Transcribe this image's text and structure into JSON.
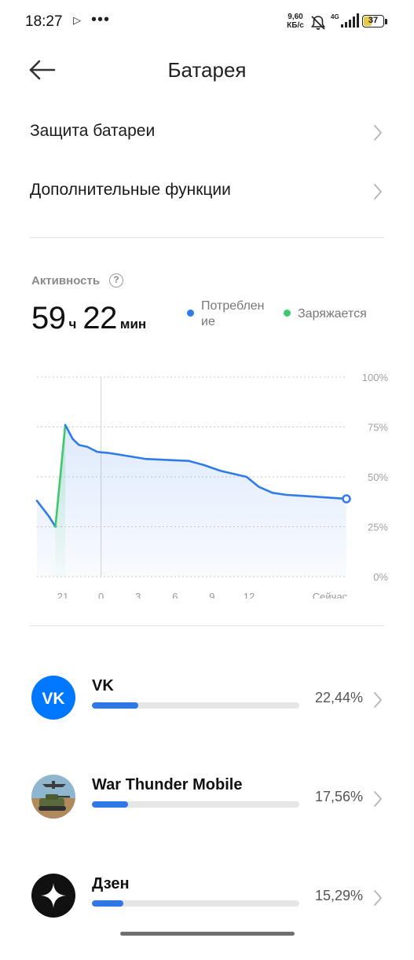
{
  "status_bar": {
    "time": "18:27",
    "speed_value": "9,60",
    "speed_unit": "КБ/с",
    "network": "4G",
    "battery": "37",
    "battery_level": 0.37
  },
  "header": {
    "title": "Батарея"
  },
  "menu": [
    {
      "label": "Защита батареи"
    },
    {
      "label": "Дополнительные функции"
    }
  ],
  "activity": {
    "label": "Активность",
    "hours": "59",
    "hours_unit": "ч",
    "minutes": "22",
    "minutes_unit": "мин"
  },
  "legend": {
    "consumption_line1": "Потреблен",
    "consumption_line2": "ие",
    "charging": "Заряжается",
    "consumption_color": "#2f7bea",
    "charging_color": "#3ec96a"
  },
  "chart_data": {
    "type": "line",
    "x_labels": [
      "21",
      "0",
      "3",
      "6",
      "9",
      "12",
      "Сейчас"
    ],
    "y_labels": [
      "100%",
      "75%",
      "50%",
      "25%",
      "0%"
    ],
    "ylim": [
      0,
      100
    ],
    "grid": true,
    "current_marker_x_label": "0",
    "series": [
      {
        "name": "Потребление",
        "color": "#2f7bea",
        "points": [
          {
            "x": 18.8,
            "y": 38
          },
          {
            "x": 19.8,
            "y": 30
          },
          {
            "x": 20.3,
            "y": 25
          }
        ]
      },
      {
        "name": "Заряжается",
        "color": "#3ec96a",
        "points": [
          {
            "x": 20.3,
            "y": 25
          },
          {
            "x": 21.1,
            "y": 76
          }
        ]
      },
      {
        "name": "Потребление",
        "color": "#2f7bea",
        "points": [
          {
            "x": 21.1,
            "y": 76
          },
          {
            "x": 21.7,
            "y": 69
          },
          {
            "x": 22.2,
            "y": 66
          },
          {
            "x": 22.9,
            "y": 65
          },
          {
            "x": 23.7,
            "y": 62.5
          },
          {
            "x": 24.6,
            "y": 62
          },
          {
            "x": 27.6,
            "y": 59
          },
          {
            "x": 31.1,
            "y": 58
          },
          {
            "x": 32.3,
            "y": 56
          },
          {
            "x": 33.7,
            "y": 53
          },
          {
            "x": 35.8,
            "y": 50
          },
          {
            "x": 36.8,
            "y": 45
          },
          {
            "x": 37.9,
            "y": 42
          },
          {
            "x": 39.0,
            "y": 41
          },
          {
            "x": 43.9,
            "y": 39
          }
        ]
      }
    ]
  },
  "apps": [
    {
      "name": "VK",
      "percent": "22,44%",
      "share": 22.44
    },
    {
      "name": "War Thunder Mobile",
      "percent": "17,56%",
      "share": 17.56
    },
    {
      "name": "Дзен",
      "percent": "15,29%",
      "share": 15.29
    }
  ]
}
